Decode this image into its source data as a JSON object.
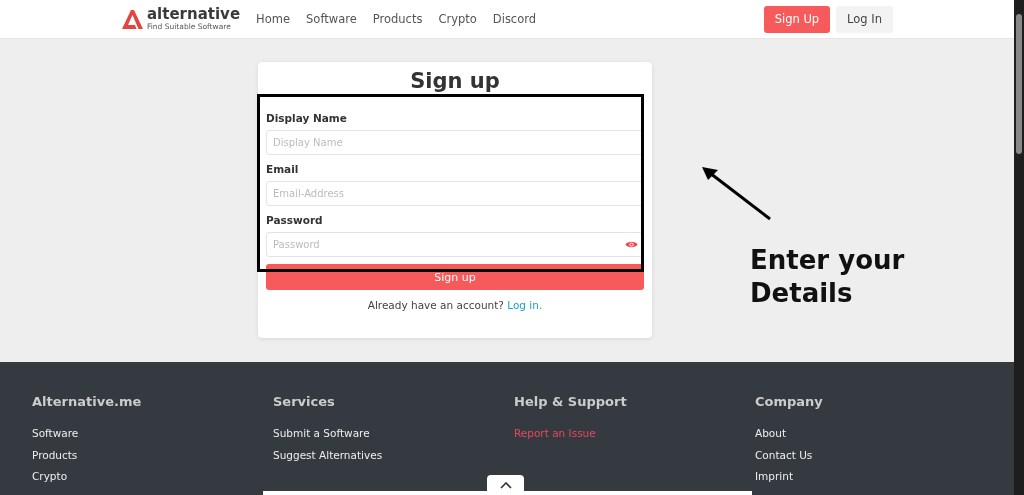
{
  "header": {
    "logo": {
      "name": "alternative",
      "tagline": "Find Suitable Software"
    },
    "nav": [
      "Home",
      "Software",
      "Products",
      "Crypto",
      "Discord"
    ],
    "signup_button": "Sign Up",
    "login_button": "Log In"
  },
  "form": {
    "title": "Sign up",
    "fields": [
      {
        "label": "Display Name",
        "placeholder": "Display Name",
        "kind": "text"
      },
      {
        "label": "Email",
        "placeholder": "Email-Address",
        "kind": "email"
      },
      {
        "label": "Password",
        "placeholder": "Password",
        "kind": "password"
      }
    ],
    "submit": "Sign up",
    "footer_text": "Already have an account?",
    "footer_link": "Log in."
  },
  "annotation": {
    "text": "Enter your Details"
  },
  "footer": {
    "columns": [
      {
        "heading": "Alternative.me",
        "links": [
          {
            "label": "Software",
            "highlighted": false
          },
          {
            "label": "Products",
            "highlighted": false
          },
          {
            "label": "Crypto",
            "highlighted": false
          }
        ]
      },
      {
        "heading": "Services",
        "links": [
          {
            "label": "Submit a Software",
            "highlighted": false
          },
          {
            "label": "Suggest Alternatives",
            "highlighted": false
          }
        ]
      },
      {
        "heading": "Help & Support",
        "links": [
          {
            "label": "Report an Issue",
            "highlighted": true
          }
        ]
      },
      {
        "heading": "Company",
        "links": [
          {
            "label": "About",
            "highlighted": false
          },
          {
            "label": "Contact Us",
            "highlighted": false
          },
          {
            "label": "Imprint",
            "highlighted": false
          }
        ]
      }
    ]
  }
}
